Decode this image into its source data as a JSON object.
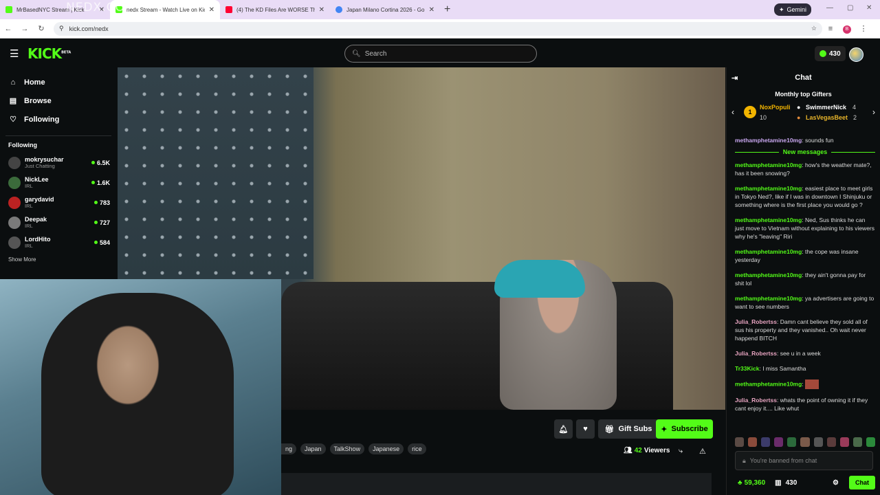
{
  "browser": {
    "tabs": [
      {
        "title": "MrBasedNYC Stream | Kick",
        "favicon_color": "#53fc18"
      },
      {
        "title": "nedx Stream - Watch Live on Kick",
        "favicon_color": "#53fc18"
      },
      {
        "title": "(4) The KD Files Are WORSE Th",
        "favicon_color": "#ff0033"
      },
      {
        "title": "Japan Milano Cortina 2026 - Go",
        "favicon_color": "#4285f4"
      }
    ],
    "new_tab": "+",
    "gemini_label": "Gemini",
    "url": "kick.com/nedx",
    "profile_initial": "B",
    "watermark": "NEDX.CO"
  },
  "header": {
    "logo": "KICK",
    "logo_sup": "BETA",
    "search_placeholder": "Search",
    "points": "430"
  },
  "sidebar": {
    "nav": [
      {
        "label": "Home",
        "icon": "home-icon"
      },
      {
        "label": "Browse",
        "icon": "browse-icon"
      },
      {
        "label": "Following",
        "icon": "heart-icon"
      }
    ],
    "following_title": "Following",
    "following": [
      {
        "name": "mokrysuchar",
        "category": "Just Chatting",
        "viewers": "6.5K"
      },
      {
        "name": "NickLee",
        "category": "IRL",
        "viewers": "1.6K"
      },
      {
        "name": "garydavid",
        "category": "IRL",
        "viewers": "783"
      },
      {
        "name": "Deepak",
        "category": "IRL",
        "viewers": "727"
      },
      {
        "name": "LordHito",
        "category": "IRL",
        "viewers": "584"
      }
    ],
    "show_more": "Show More"
  },
  "stream": {
    "gift_subs": "Gift Subs",
    "subscribe": "Subscribe",
    "tags": [
      "ng",
      "Japan",
      "TalkShow",
      "Japanese",
      "rice"
    ],
    "viewers_count": "42",
    "viewers_label": "Viewers"
  },
  "chat": {
    "title": "Chat",
    "gifters_title": "Monthly top Gifters",
    "gifters": [
      {
        "rank": "1",
        "name": "NoxPopuli",
        "count": "10"
      },
      {
        "name": "SwimmerNick",
        "count": "4"
      },
      {
        "name": "LasVegasBeet",
        "count": "2"
      }
    ],
    "top_partial": {
      "user": "methamphetamine10mg",
      "text": "sounds fun"
    },
    "new_messages_label": "New messages",
    "messages": [
      {
        "user": "methamphetamine10mg",
        "text": "how's the weather mate?, has it been snowing?"
      },
      {
        "user": "methamphetamine10mg",
        "text": "easiest place to meet girls in Tokyo Ned?, like if I was in downtown I Shinjuku or something where is the first place you would go ?"
      },
      {
        "user": "methamphetamine10mg",
        "text": "Ned, Sus thinks he can just move to Vietnam without explaining to his viewers why he's \"leaving\" Riri"
      },
      {
        "user": "methamphetamine10mg",
        "text": "the cope was insane yesterday"
      },
      {
        "user": "methamphetamine10mg",
        "text": "they ain't gonna pay for shit lol"
      },
      {
        "user": "methamphetamine10mg",
        "text": "ya advertisers are going to want to see numbers"
      },
      {
        "user": "Julia_Robertss",
        "text": "Damn cant believe they sold all of sus his property and they vanished.. Oh wait never happend BITCH"
      },
      {
        "user": "Julia_Robertss",
        "text": "see u in a week"
      },
      {
        "user": "Tr33Kick",
        "text": "I miss Samantha"
      },
      {
        "user": "methamphetamine10mg",
        "text": ""
      },
      {
        "user": "Julia_Robertss",
        "text": "whats the point of owning it if they cant enjoy it.... Like whut"
      }
    ],
    "banned_text": "You're banned from chat",
    "footer_kicks": "59,360",
    "footer_points": "430",
    "chat_button": "Chat"
  },
  "colors": {
    "accent": "#53fc18",
    "bg": "#0b0e0f",
    "purple_user": "#c9a7f0"
  }
}
